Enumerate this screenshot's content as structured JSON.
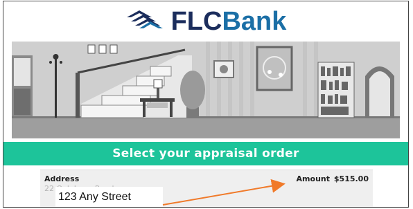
{
  "brand": {
    "logo_icon": "flc-chevron-logo",
    "name_part1": "FLC",
    "name_part2": "Bank",
    "colors": {
      "dark": "#1b2d5c",
      "blue": "#1b6fa6"
    }
  },
  "hero": {
    "illustration": "house-interior-staircase"
  },
  "banner": {
    "title": "Select your appraisal order",
    "color": "#1dc49a"
  },
  "order": {
    "address_label": "Address",
    "address_value_faded": "22 Oak Lane Road",
    "amount_label": "Amount",
    "amount_value": "$515.00"
  },
  "annotation": {
    "callout_text": "123 Any Street",
    "arrow_color": "#f07a2a"
  }
}
